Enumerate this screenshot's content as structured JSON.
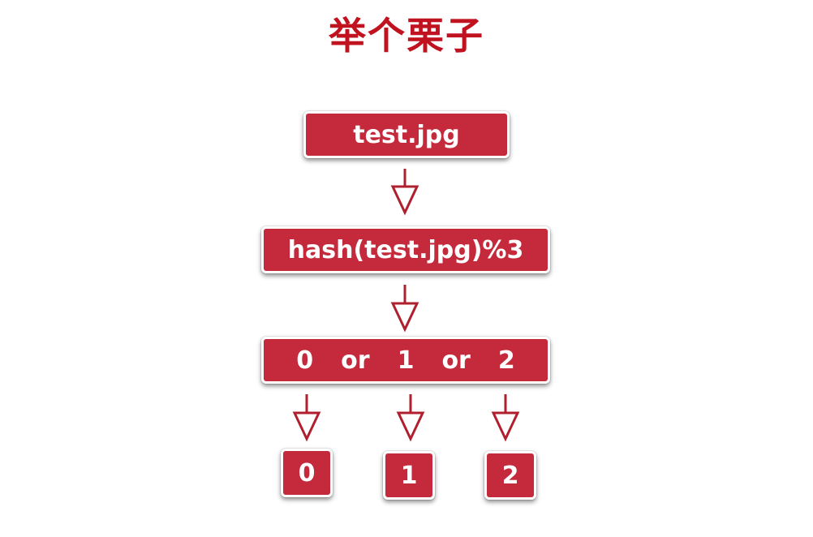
{
  "title": "举个栗子",
  "nodes": {
    "file": "test.jpg",
    "hash": "hash(test.jpg)%3",
    "result": {
      "values": [
        "0",
        "1",
        "2"
      ],
      "connector": "or"
    }
  },
  "buckets": [
    "0",
    "1",
    "2"
  ],
  "colors": {
    "title": "#c0121f",
    "box_fill": "#c42a3b",
    "box_text": "#ffffff",
    "arrow": "#b01f2e"
  }
}
